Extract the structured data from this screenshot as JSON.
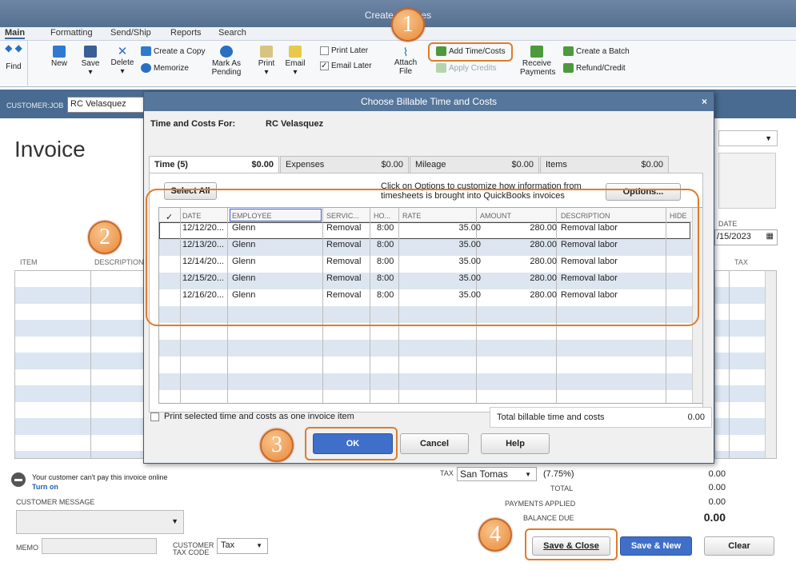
{
  "window": {
    "title": "Create Invoices"
  },
  "menu_tabs": [
    "Main",
    "Formatting",
    "Send/Ship",
    "Reports",
    "Search"
  ],
  "ribbon": {
    "find": "Find",
    "new": "New",
    "save": "Save",
    "delete": "Delete",
    "create_copy": "Create a Copy",
    "memorize": "Memorize",
    "mark_as_pending_1": "Mark As",
    "mark_as_pending_2": "Pending",
    "print": "Print",
    "email": "Email",
    "print_later": "Print Later",
    "email_later": "Email Later",
    "attach_1": "Attach",
    "attach_2": "File",
    "add_time_costs": "Add Time/Costs",
    "apply_credits": "Apply Credits",
    "receive_payments_1": "Receive",
    "receive_payments_2": "Payments",
    "create_batch": "Create a Batch",
    "refund_credit": "Refund/Credit"
  },
  "customer_job": {
    "label": "CUSTOMER:JOB",
    "value": "RC Velasquez"
  },
  "invoice": {
    "title": "Invoice",
    "date_label": "DATE",
    "date_value": "/15/2023",
    "col_item": "ITEM",
    "col_description": "DESCRIPTION",
    "col_tax": "TAX"
  },
  "dialog": {
    "title": "Choose Billable Time and Costs",
    "time_and_costs_for_label": "Time and Costs For:",
    "customer": "RC Velasquez",
    "tabs": [
      {
        "label": "Time (5)",
        "amount": "$0.00"
      },
      {
        "label": "Expenses",
        "amount": "$0.00"
      },
      {
        "label": "Mileage",
        "amount": "$0.00"
      },
      {
        "label": "Items",
        "amount": "$0.00"
      }
    ],
    "select_all": "Select All",
    "options_hint": "Click on Options   to customize how information from timesheets is brought into QuickBooks invoices",
    "options_button": "Options...",
    "columns": {
      "check": "✓",
      "date": "DATE",
      "employee": "EMPLOYEE",
      "service": "SERVIC...",
      "hours": "HO...",
      "rate": "RATE",
      "amount": "AMOUNT",
      "description": "DESCRIPTION",
      "hide": "HIDE"
    },
    "rows": [
      {
        "date": "12/12/20...",
        "employee": "Glenn",
        "service": "Removal",
        "hours": "8:00",
        "rate": "35.00",
        "amount": "280.00",
        "description": "Removal labor"
      },
      {
        "date": "12/13/20...",
        "employee": "Glenn",
        "service": "Removal",
        "hours": "8:00",
        "rate": "35.00",
        "amount": "280.00",
        "description": "Removal labor"
      },
      {
        "date": "12/14/20...",
        "employee": "Glenn",
        "service": "Removal",
        "hours": "8:00",
        "rate": "35.00",
        "amount": "280.00",
        "description": "Removal labor"
      },
      {
        "date": "12/15/20...",
        "employee": "Glenn",
        "service": "Removal",
        "hours": "8:00",
        "rate": "35.00",
        "amount": "280.00",
        "description": "Removal labor"
      },
      {
        "date": "12/16/20...",
        "employee": "Glenn",
        "service": "Removal",
        "hours": "8:00",
        "rate": "35.00",
        "amount": "280.00",
        "description": "Removal labor"
      }
    ],
    "print_selected": "Print selected time and costs as one invoice item",
    "total_label": "Total billable time and costs",
    "total_value": "0.00",
    "ok": "OK",
    "cancel": "Cancel",
    "help": "Help"
  },
  "footer": {
    "online_msg": "Your customer can't pay this invoice online",
    "turn_on": "Turn on",
    "customer_message": "CUSTOMER MESSAGE",
    "memo": "MEMO",
    "customer_tax_code_1": "CUSTOMER",
    "customer_tax_code_2": "TAX CODE",
    "tax_code_value": "Tax",
    "tax_label": "TAX",
    "tax_value": "San Tomas",
    "tax_rate": "(7.75%)",
    "tax_amount": "0.00",
    "total_label": "TOTAL",
    "total_value": "0.00",
    "payments_label": "PAYMENTS APPLIED",
    "payments_value": "0.00",
    "balance_label": "BALANCE DUE",
    "balance_value": "0.00",
    "save_close": "Save & Close",
    "save_new": "Save & New",
    "clear": "Clear"
  },
  "step_badges": [
    "1",
    "2",
    "3",
    "4"
  ],
  "colors": {
    "accent": "#e07b2a",
    "titlebar": "#56769c",
    "primary_button": "#3f6fc9"
  }
}
